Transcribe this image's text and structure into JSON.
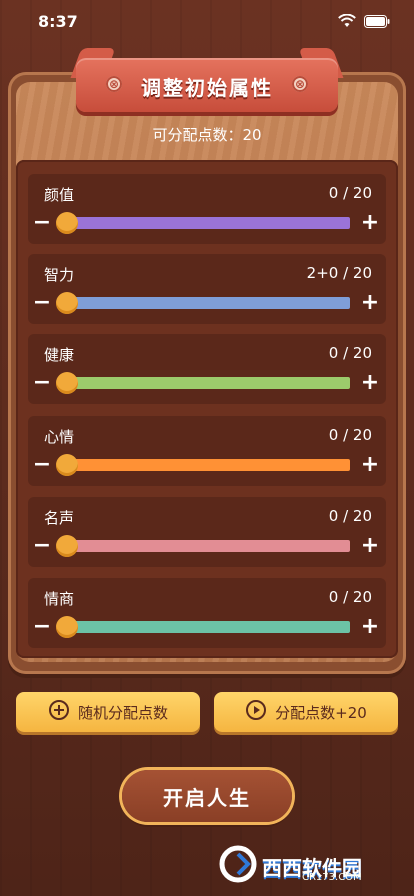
{
  "status_bar": {
    "time": "8:37"
  },
  "header": {
    "title": "调整初始属性",
    "screw_symbol": "⊗"
  },
  "points": {
    "label": "可分配点数：20"
  },
  "attributes": [
    {
      "name": "颜值",
      "value": "0 / 20",
      "color": "#9a73d8",
      "fill_fraction": 0
    },
    {
      "name": "智力",
      "value": "2+0 / 20",
      "color": "#7f9ed8",
      "fill_fraction": 0
    },
    {
      "name": "健康",
      "value": "0 / 20",
      "color": "#9ccb6b",
      "fill_fraction": 0
    },
    {
      "name": "心情",
      "value": "0 / 20",
      "color": "#ff9135",
      "fill_fraction": 0
    },
    {
      "name": "名声",
      "value": "0 / 20",
      "color": "#e28d94",
      "fill_fraction": 0
    },
    {
      "name": "情商",
      "value": "0 / 20",
      "color": "#6cc2a6",
      "fill_fraction": 0
    }
  ],
  "controls": {
    "minus": "−",
    "plus": "+"
  },
  "actions": {
    "random_label": "随机分配点数",
    "add_label": "分配点数+20"
  },
  "start_button": {
    "label": "开启人生"
  },
  "watermark": {
    "text": "西西软件园",
    "subtext": "CR173.COM"
  },
  "colors": {
    "accent_red": "#d45c48",
    "button_yellow": "#f5b540",
    "thumb_orange": "#f1a93a"
  }
}
